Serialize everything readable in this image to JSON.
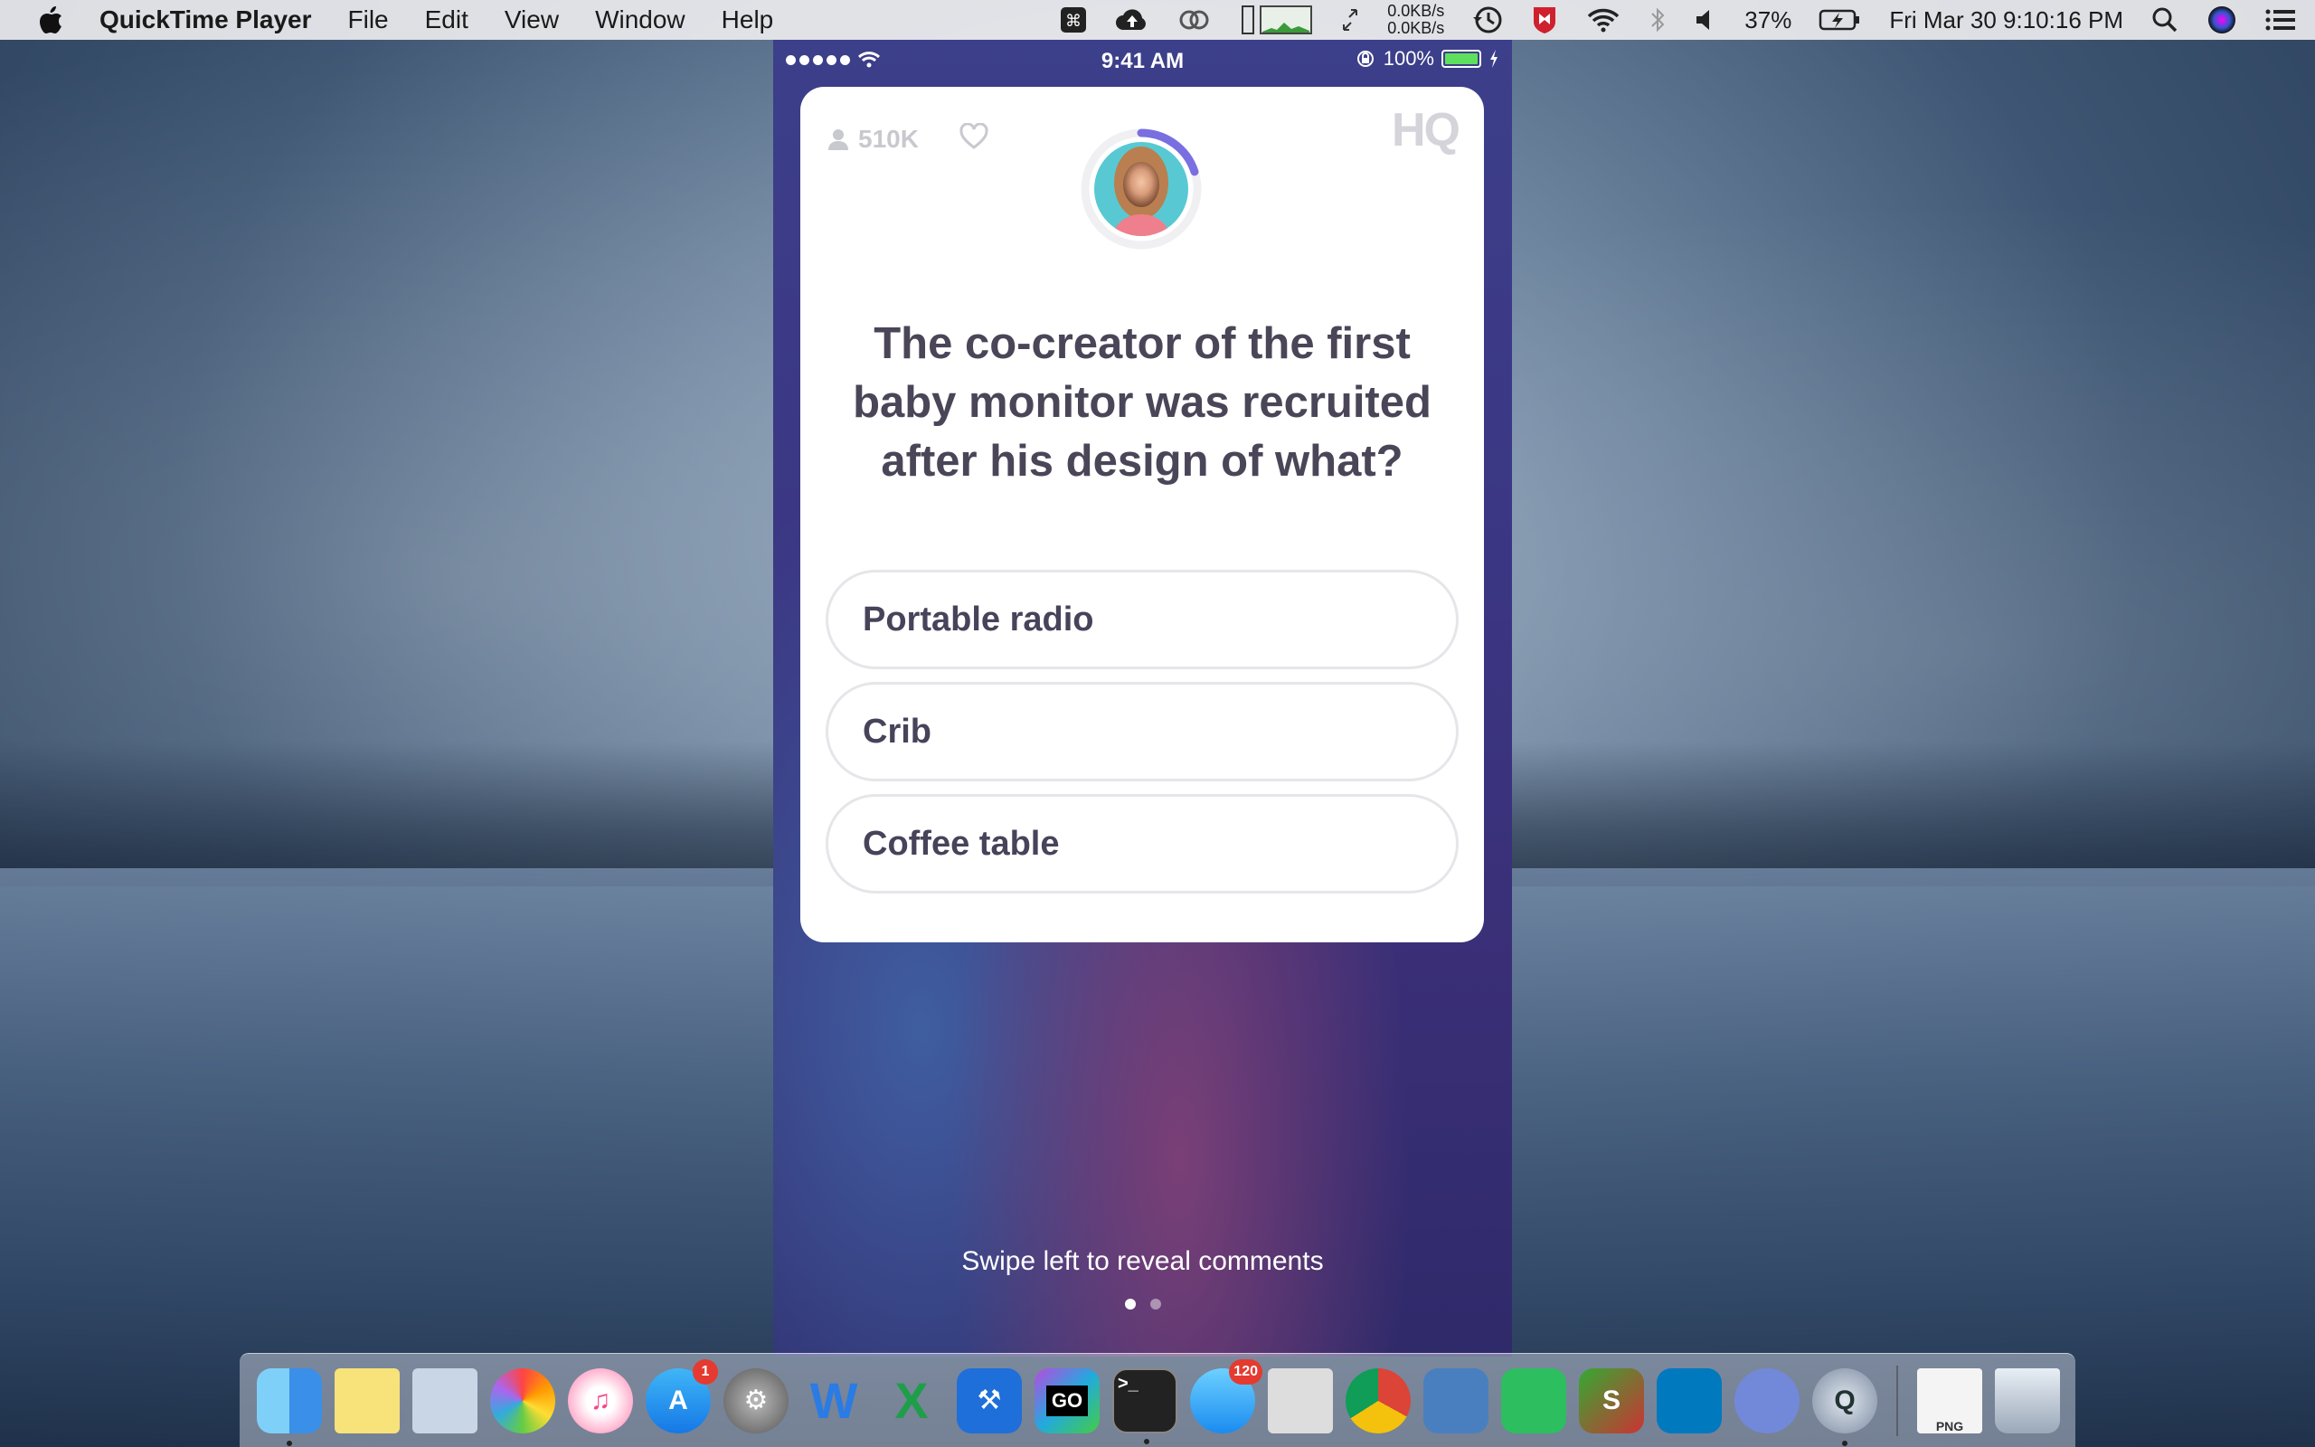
{
  "menubar": {
    "app_name": "QuickTime Player",
    "menus": [
      "File",
      "Edit",
      "View",
      "Window",
      "Help"
    ],
    "net_up": "0.0KB/s",
    "net_down": "0.0KB/s",
    "battery_percent": "37%",
    "datetime": "Fri Mar 30  9:10:16 PM"
  },
  "phone": {
    "status": {
      "time": "9:41 AM",
      "battery": "100%"
    },
    "card": {
      "viewers": "510K",
      "logo": "HQ",
      "question": "The co-creator of the first baby monitor was recruited after his design of what?",
      "answers": [
        "Portable radio",
        "Crib",
        "Coffee table"
      ],
      "timer_progress": 0.2
    },
    "swipe_hint": "Swipe left to reveal comments"
  },
  "dock": {
    "app_store_badge": "1",
    "messages_badge": "120",
    "goland_label": "GO",
    "png_label": "PNG"
  },
  "colors": {
    "accent": "#7a6fe0",
    "question_text": "#4a4658",
    "answer_border": "#e6e6ea"
  }
}
